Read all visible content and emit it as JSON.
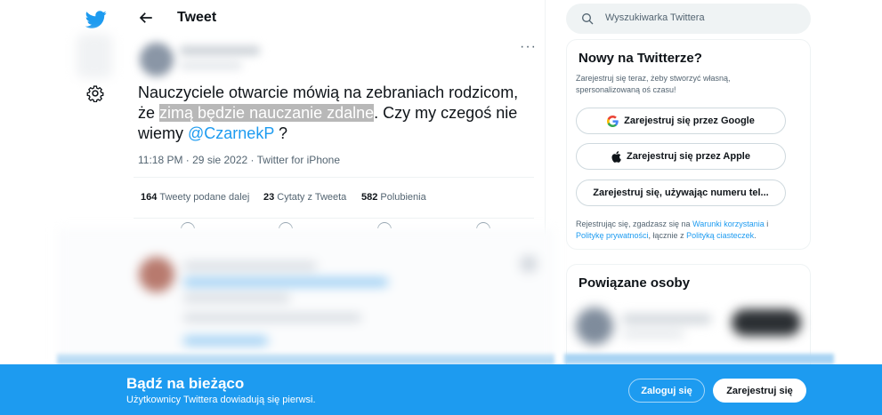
{
  "nav": {
    "logo_icon": "twitter-bird-icon",
    "settings_icon": "gear-icon"
  },
  "header": {
    "back_icon": "arrow-left-icon",
    "title": "Tweet"
  },
  "tweet": {
    "text_part1": "Nauczyciele otwarcie mówią na zebraniach rodzicom, że ",
    "highlighted": "zimą będzie nauczanie zdalne",
    "text_part2": ". Czy my czegoś nie wiemy ",
    "mention": "@CzarnekP",
    "text_part3": " ?",
    "more_icon": "more-dots-icon",
    "more_label": "···",
    "meta": "11:18 PM · 29 sie 2022 · Twitter for iPhone",
    "stats": {
      "retweets_count": "164",
      "retweets_label": "Tweety podane dalej",
      "quotes_count": "23",
      "quotes_label": "Cytaty z Tweeta",
      "likes_count": "582",
      "likes_label": "Polubienia"
    }
  },
  "search": {
    "placeholder": "Wyszukiwarka Twittera",
    "icon": "search-icon"
  },
  "signup": {
    "title": "Nowy na Twitterze?",
    "desc": "Zarejestruj się teraz, żeby stworzyć własną, spersonalizowaną oś czasu!",
    "google_label": "Zarejestruj się przez Google",
    "apple_label": "Zarejestruj się przez Apple",
    "phone_label": "Zarejestruj się, używając numeru tel...",
    "terms_1": "Rejestrując się, zgadzasz się na ",
    "terms_link1": "Warunki korzystania",
    "terms_2": " i ",
    "terms_link2": "Politykę prywatności",
    "terms_3": ", łącznie z ",
    "terms_link3": "Polityką ciasteczek",
    "terms_4": "."
  },
  "related": {
    "title": "Powiązane osoby"
  },
  "banner": {
    "title": "Bądź na bieżąco",
    "subtitle": "Użytkownicy Twittera dowiadują się pierwsi.",
    "login_label": "Zaloguj się",
    "register_label": "Zarejestruj się"
  },
  "colors": {
    "accent": "#1d9bf0",
    "text": "#0f1419",
    "muted": "#536471"
  }
}
